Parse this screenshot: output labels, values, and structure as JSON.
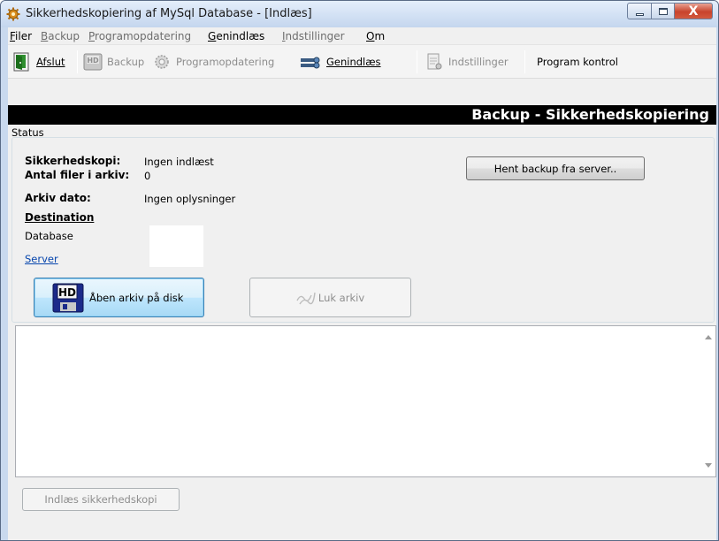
{
  "window": {
    "title": "Sikkerhedskopiering af MySql Database - [Indlæs]",
    "close_glyph": "X"
  },
  "menu": [
    {
      "label": "Filer",
      "ul": "F",
      "rest": "iler",
      "enabled": true
    },
    {
      "label": "Backup",
      "ul": "B",
      "rest": "ackup",
      "enabled": false
    },
    {
      "label": "Programopdatering",
      "ul": "P",
      "rest": "rogramopdatering",
      "enabled": false
    },
    {
      "label": "Genindlæs",
      "ul": "G",
      "rest": "enindlæs",
      "enabled": true
    },
    {
      "label": "Indstillinger",
      "ul": "I",
      "rest": "ndstillinger",
      "enabled": false
    },
    {
      "label": "Om",
      "ul": "O",
      "rest": "m",
      "enabled": true
    }
  ],
  "toolbar": {
    "afslut": "Afslut",
    "backup": "Backup",
    "programopdatering": "Programopdatering",
    "genindlaes": "Genindlæs",
    "indstillinger": "Indstillinger",
    "program_kontrol": "Program kontrol"
  },
  "header": "Backup - Sikkerhedskopiering",
  "status": {
    "group_label": "Status",
    "sikkerhedskopi_label": "Sikkerhedskopi:",
    "sikkerhedskopi_value": "Ingen indlæst",
    "antal_label": "Antal filer i arkiv:",
    "antal_value": "0",
    "arkiv_dato_label": "Arkiv dato:",
    "arkiv_dato_value": "Ingen oplysninger",
    "destination_label": "Destination",
    "database_label": "Database",
    "server_link": "Server",
    "hent_button": "Hent backup fra server..",
    "aaben_button": "Åben arkiv på disk",
    "luk_button": "Luk arkiv",
    "hd_badge": "HD"
  },
  "footer": {
    "indlaes_button": "Indlæs sikkerhedskopi"
  },
  "colors": {
    "header_bg": "#000000",
    "link": "#0645ad",
    "close_button": "#c8432c"
  }
}
